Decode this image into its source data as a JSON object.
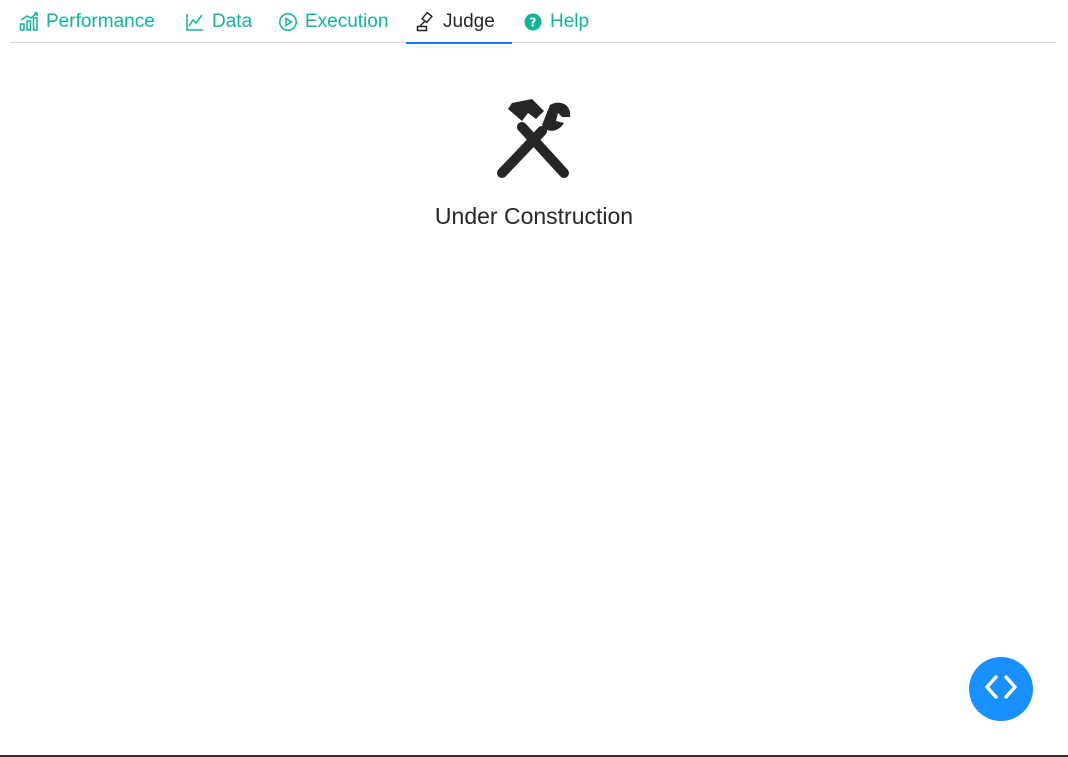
{
  "tabs": [
    {
      "label": "Performance",
      "icon": "bar-chart-icon"
    },
    {
      "label": "Data",
      "icon": "line-chart-icon"
    },
    {
      "label": "Execution",
      "icon": "play-circle-icon"
    },
    {
      "label": "Judge",
      "icon": "gavel-icon",
      "active": true
    },
    {
      "label": "Help",
      "icon": "question-circle-icon"
    }
  ],
  "main": {
    "icon": "tools-icon",
    "message": "Under Construction"
  },
  "fab": {
    "icon": "code-icon"
  },
  "colors": {
    "tab_text": "#13b39a",
    "active_tab_text": "#262626",
    "active_underline": "#1677ff",
    "fab_background": "#1890ff",
    "icon_dark": "#262626"
  }
}
